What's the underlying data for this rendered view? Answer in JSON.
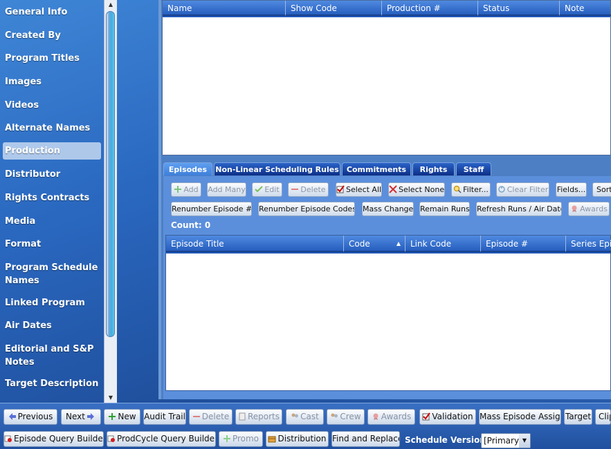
{
  "sidebar": {
    "items": [
      {
        "label": "General Info"
      },
      {
        "label": "Created By"
      },
      {
        "label": "Program Titles"
      },
      {
        "label": "Images"
      },
      {
        "label": "Videos"
      },
      {
        "label": "Alternate Names"
      },
      {
        "label": "Production",
        "selected": true
      },
      {
        "label": "Distributor"
      },
      {
        "label": "Rights Contracts"
      },
      {
        "label": "Media"
      },
      {
        "label": "Format"
      },
      {
        "label": "Program Schedule Names"
      },
      {
        "label": "Linked Program"
      },
      {
        "label": "Air Dates"
      },
      {
        "label": "Editorial and S&P Notes"
      },
      {
        "label": "Target Description"
      }
    ]
  },
  "top_grid": {
    "columns": [
      "Name",
      "Show Code",
      "Production #",
      "Status",
      "Note"
    ]
  },
  "tabs": [
    "Episodes",
    "Non-Linear Scheduling Rules",
    "Commitments",
    "Rights",
    "Staff"
  ],
  "active_tab": "Episodes",
  "episode_toolbar": {
    "row1": [
      "Add",
      "Add Many",
      "Edit",
      "Delete",
      "Select All",
      "Select None",
      "Filter...",
      "Clear Filter",
      "Fields...",
      "Sorti"
    ],
    "row2": [
      "Renumber Episode #...",
      "Renumber Episode Codes...",
      "Mass Change",
      "Remain Runs",
      "Refresh Runs / Air Dates",
      "Awards"
    ]
  },
  "count_label": "Count: 0",
  "episode_grid": {
    "columns": [
      "Episode Title",
      "Code",
      "Link Code",
      "Episode #",
      "Series Episo"
    ],
    "sort_indicator": "▲"
  },
  "bottom_bar": {
    "row1": [
      "Previous",
      "Next",
      "New",
      "Audit Trail",
      "Delete",
      "Reports",
      "Cast",
      "Crew",
      "Awards",
      "Validation",
      "Mass Episode Assign",
      "Target",
      "Clip"
    ],
    "row2": [
      "Episode Query Builder",
      "ProdCycle Query Builder",
      "Promo",
      "Distribution",
      "Find and Replace"
    ],
    "schedule_label": "Schedule Version:",
    "schedule_value": "[Primary]"
  },
  "icons": {
    "scroll_up": "▲",
    "scroll_down": "▼",
    "dropdown": "▼"
  },
  "colors": {
    "accent": "#1f56b8",
    "panel": "#5b8fdc"
  }
}
